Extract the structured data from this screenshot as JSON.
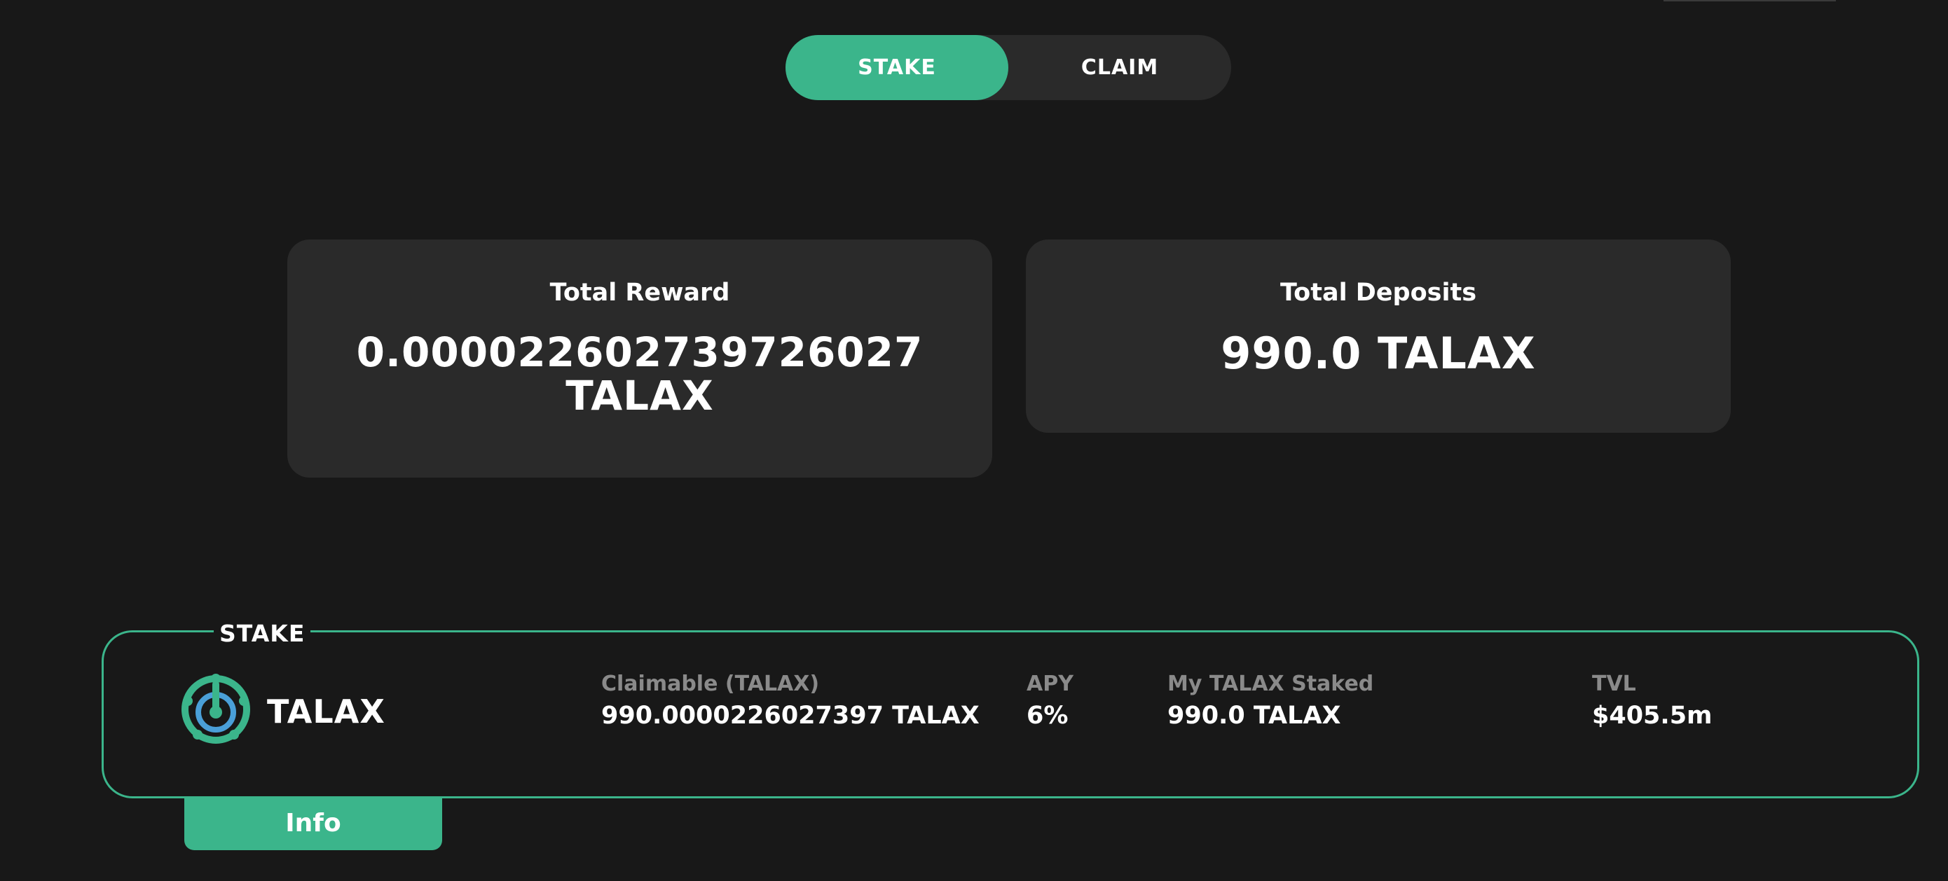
{
  "tabs": {
    "stake_label": "STAKE",
    "claim_label": "CLAIM",
    "active": "STAKE"
  },
  "reward_card": {
    "title": "Total Reward",
    "value": "0.000022602739726027 TALAX"
  },
  "deposits_card": {
    "title": "Total Deposits",
    "value": "990.0 TALAX"
  },
  "stake_panel": {
    "legend": "STAKE",
    "token": {
      "name": "TALAX",
      "icon": "talax-logo-icon"
    },
    "stats": [
      {
        "label": "Claimable (TALAX)",
        "value": "990.0000226027397 TALAX"
      },
      {
        "label": "APY",
        "value": "6%"
      },
      {
        "label": "My TALAX Staked",
        "value": "990.0 TALAX"
      },
      {
        "label": "TVL",
        "value": "$405.5m"
      }
    ],
    "info_label": "Info"
  },
  "colors": {
    "accent": "#3bb58b",
    "background": "#181818",
    "card": "#2a2a2a",
    "muted_text": "#8a8a8a",
    "logo_inner": "#4a9fd8"
  }
}
